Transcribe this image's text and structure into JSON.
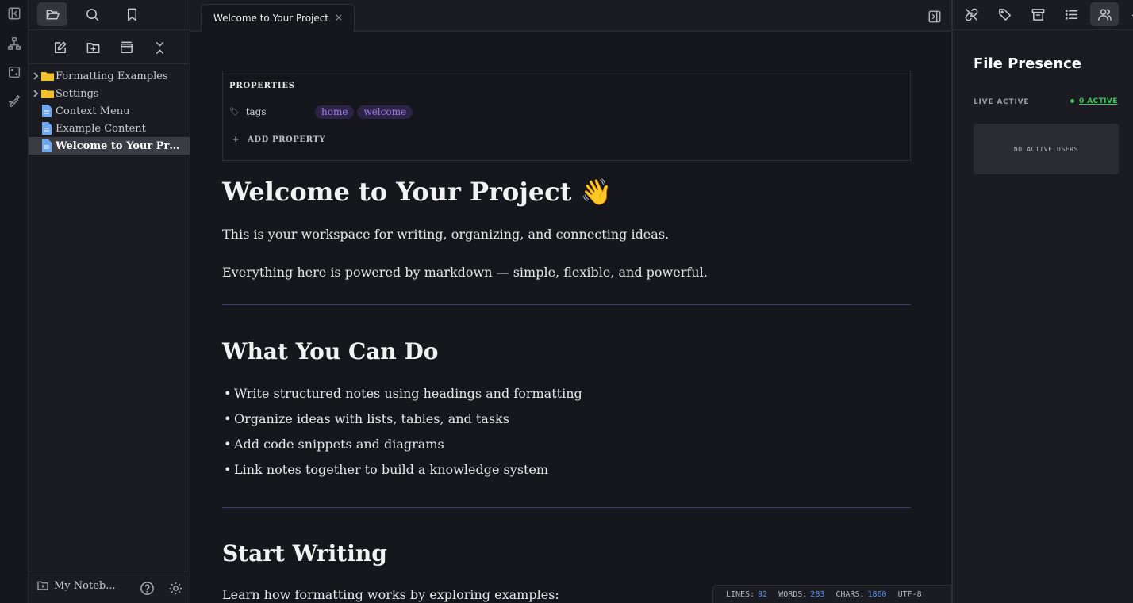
{
  "sidebar": {
    "tree": [
      {
        "label": "Formatting Examples",
        "type": "folder"
      },
      {
        "label": "Settings",
        "type": "folder"
      },
      {
        "label": "Context Menu",
        "type": "file"
      },
      {
        "label": "Example Content",
        "type": "file"
      },
      {
        "label": "Welcome to Your Proj...",
        "type": "file",
        "active": true
      }
    ],
    "vault_name": "My Noteb..."
  },
  "tab": {
    "title": "Welcome to Your Project",
    "close": "×"
  },
  "properties": {
    "title": "PROPERTIES",
    "key": "tags",
    "tags": [
      "home",
      "welcome"
    ],
    "add_label": "ADD PROPERTY",
    "add_icon": "+"
  },
  "document": {
    "title": "Welcome to Your Project",
    "title_emoji": "👋",
    "intro_1": "This is your workspace for writing, organizing, and connecting ideas.",
    "intro_2": "Everything here is powered by markdown — simple, flexible, and powerful.",
    "heading_2": "What You Can Do",
    "bullets": [
      "Write structured notes using headings and formatting",
      "Organize ideas with lists, tables, and tasks",
      "Add code snippets and diagrams",
      "Link notes together to build a knowledge system"
    ],
    "heading_3": "Start Writing",
    "para_3": "Learn how formatting works by exploring examples:"
  },
  "statusbar": {
    "lines_label": "LINES:",
    "lines": "92",
    "words_label": "WORDS:",
    "words": "283",
    "chars_label": "CHARS:",
    "chars": "1860",
    "encoding": "UTF-8"
  },
  "right_panel": {
    "title": "File Presence",
    "live_label": "LIVE ACTIVE",
    "active_count": "0 ACTIVE",
    "empty_text": "NO ACTIVE USERS"
  },
  "colors": {
    "accent_purple": "#9b7cf0",
    "tag_bg": "#2c2346",
    "status_num": "#5a93f0",
    "active_green": "#3ec45e",
    "folder": "#f2c12e",
    "file": "#6ea8f0"
  }
}
